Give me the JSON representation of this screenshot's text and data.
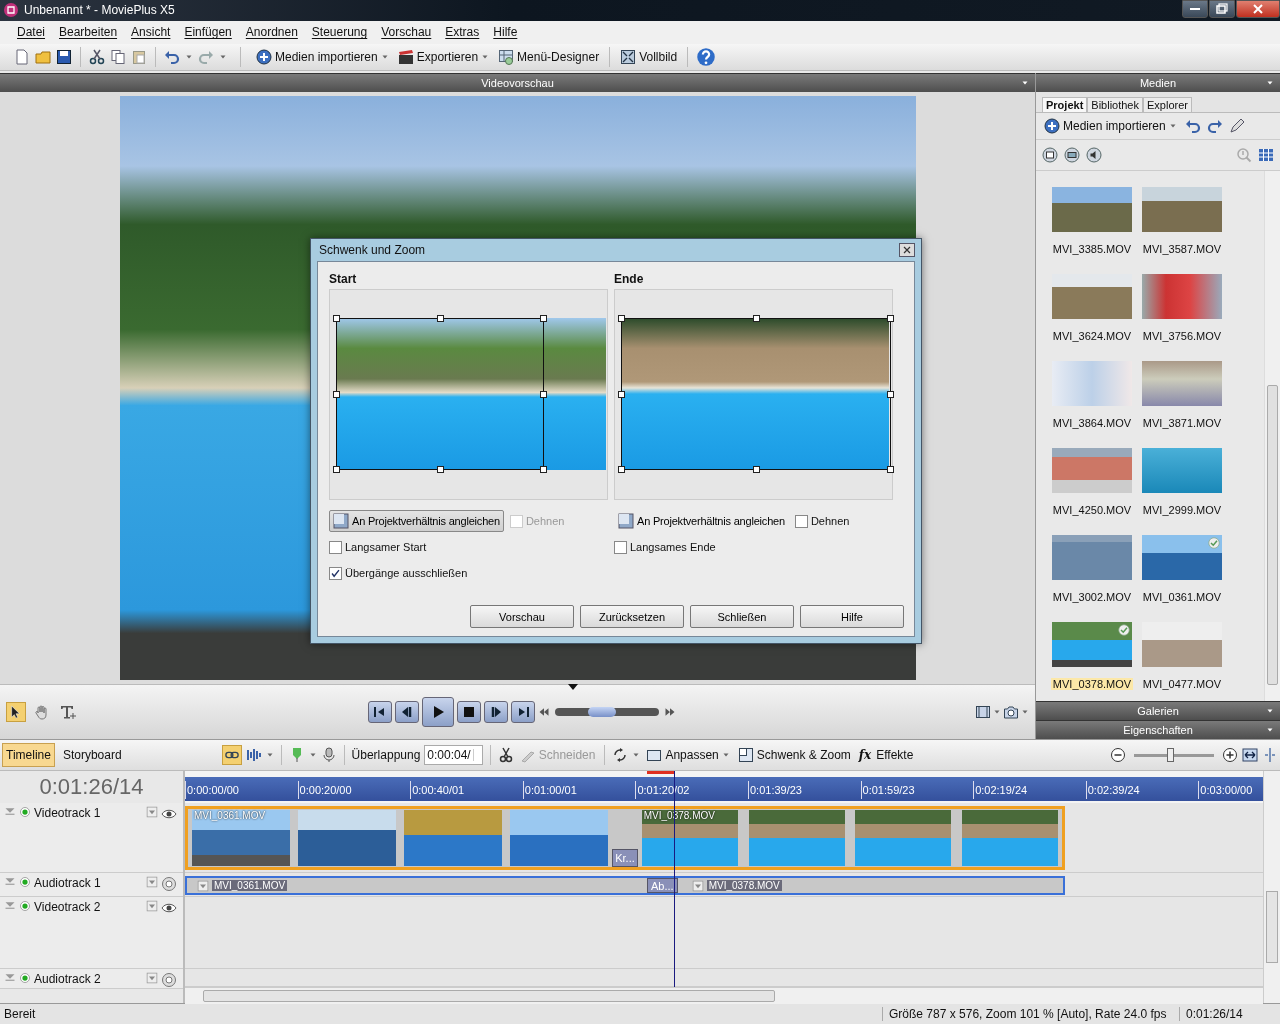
{
  "window": {
    "title": "Unbenannt * - MoviePlus X5"
  },
  "menu": [
    "Datei",
    "Bearbeiten",
    "Ansicht",
    "Einfügen",
    "Anordnen",
    "Steuerung",
    "Vorschau",
    "Extras",
    "Hilfe"
  ],
  "toolbar": {
    "import": "Medien importieren",
    "export": "Exportieren",
    "menu_designer": "Menü-Designer",
    "fullscreen": "Vollbild"
  },
  "preview": {
    "title": "Videovorschau",
    "scrub": {
      "level": 0.45
    }
  },
  "dialog": {
    "title": "Schwenk und Zoom",
    "panes": [
      {
        "heading": "Start",
        "fit": {
          "label": "An Projektverhältnis angleichen",
          "pressed": true
        },
        "stretch": {
          "label": "Dehnen",
          "checked": false,
          "disabled": true
        },
        "slow": {
          "label": "Langsamer Start",
          "checked": false
        }
      },
      {
        "heading": "Ende",
        "fit": {
          "label": "An Projektverhältnis angleichen",
          "pressed": false
        },
        "stretch": {
          "label": "Dehnen",
          "checked": false,
          "disabled": false
        },
        "slow": {
          "label": "Langsames Ende",
          "checked": false
        }
      }
    ],
    "exclude": {
      "label": "Übergänge ausschließen",
      "checked": true
    },
    "buttons": [
      "Vorschau",
      "Zurücksetzen",
      "Schließen",
      "Hilfe"
    ]
  },
  "media": {
    "title": "Medien",
    "tabs": [
      {
        "label": "Projekt",
        "selected": true
      },
      {
        "label": "Bibliothek",
        "selected": false
      },
      {
        "label": "Explorer",
        "selected": false
      }
    ],
    "import": "Medien importieren",
    "items": [
      {
        "name": "MVI_3385.MOV",
        "selected": false,
        "in_use": false
      },
      {
        "name": "MVI_3587.MOV",
        "selected": false,
        "in_use": false
      },
      {
        "name": "MVI_3624.MOV",
        "selected": false,
        "in_use": false
      },
      {
        "name": "MVI_3756.MOV",
        "selected": false,
        "in_use": false
      },
      {
        "name": "MVI_3864.MOV",
        "selected": false,
        "in_use": false
      },
      {
        "name": "MVI_3871.MOV",
        "selected": false,
        "in_use": false
      },
      {
        "name": "MVI_4250.MOV",
        "selected": false,
        "in_use": false
      },
      {
        "name": "MVI_2999.MOV",
        "selected": false,
        "in_use": false
      },
      {
        "name": "MVI_3002.MOV",
        "selected": false,
        "in_use": false
      },
      {
        "name": "MVI_0361.MOV",
        "selected": false,
        "in_use": true
      },
      {
        "name": "MVI_0378.MOV",
        "selected": true,
        "in_use": true
      },
      {
        "name": "MVI_0477.MOV",
        "selected": false,
        "in_use": false
      }
    ],
    "galleries": "Galerien",
    "properties": "Eigenschaften"
  },
  "timeline_toolbar": {
    "tabs": [
      {
        "label": "Timeline",
        "selected": true
      },
      {
        "label": "Storyboard",
        "selected": false
      }
    ],
    "overlap_label": "Überlappung",
    "overlap_value": "0:00:04/",
    "cut": {
      "label": "Schneiden",
      "disabled": true
    },
    "fit": "Anpassen",
    "pan_zoom": "Schwenk & Zoom",
    "effects_glyph": "fx",
    "effects": "Effekte",
    "zoom": {
      "level": 0.45
    }
  },
  "timeline": {
    "time": "0:01:26/14",
    "ruler": [
      "0:00:00/00",
      "0:00:20/00",
      "0:00:40/01",
      "0:01:00/01",
      "0:01:20/02",
      "0:01:39/23",
      "0:01:59/23",
      "0:02:19/24",
      "0:02:39/24",
      "0:03:00/00"
    ],
    "tracks": [
      {
        "name": "Videotrack 1",
        "kind": "video"
      },
      {
        "name": "Audiotrack 1",
        "kind": "audio"
      },
      {
        "name": "Videotrack 2",
        "kind": "video"
      },
      {
        "name": "Audiotrack 2",
        "kind": "audio"
      }
    ],
    "video_clips": [
      {
        "name": "MVI_0361.MOV",
        "transition": "Kr..."
      },
      {
        "name": "MVI_0378.MOV"
      }
    ],
    "audio_clips": [
      {
        "name": "MVI_0361.MOV",
        "transition": "Ab..."
      },
      {
        "name": "MVI_0378.MOV"
      }
    ]
  },
  "status": {
    "left": "Bereit",
    "info": "Größe 787 x 576, Zoom 101 % [Auto], Rate 24.0 fps",
    "time": "0:01:26/14"
  }
}
